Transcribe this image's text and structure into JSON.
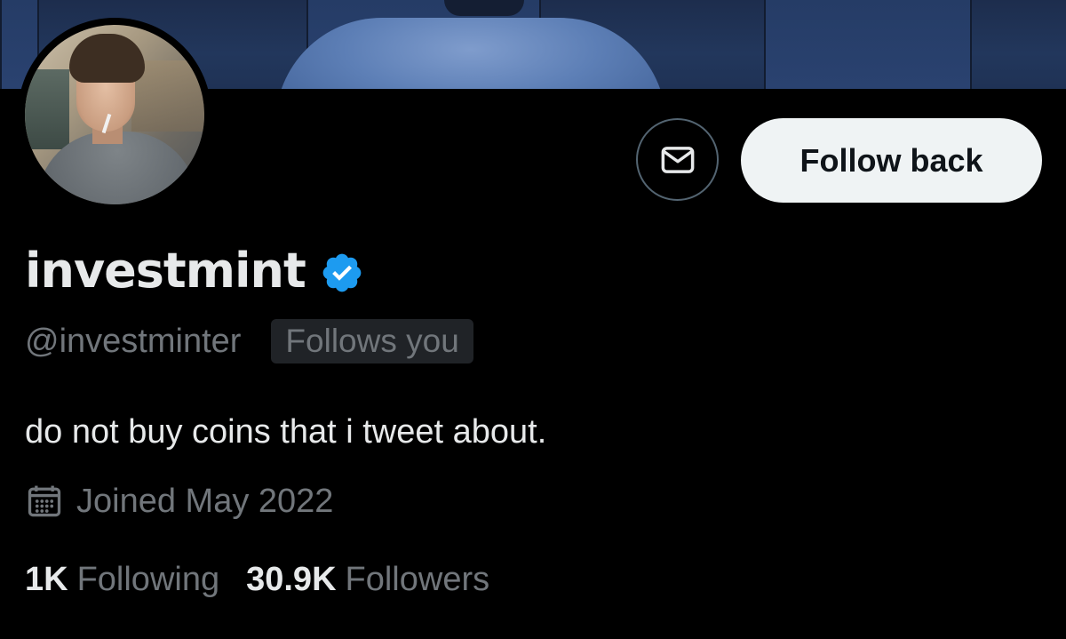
{
  "profile": {
    "display_name": "investmint",
    "verified": true,
    "handle": "@investminter",
    "follows_you_badge": "Follows you",
    "bio": "do not buy coins that i tweet about.",
    "joined": "Joined May 2022"
  },
  "actions": {
    "follow_back_label": "Follow back",
    "message_icon": "envelope-icon"
  },
  "stats": {
    "following_count": "1K",
    "following_label": "Following",
    "followers_count": "30.9K",
    "followers_label": "Followers"
  },
  "colors": {
    "background": "#000000",
    "primary_text": "#e7e9ea",
    "secondary_text": "#71767b",
    "verified_blue": "#1d9bf0",
    "follow_button_bg": "#eff3f4",
    "badge_bg": "#202327"
  }
}
